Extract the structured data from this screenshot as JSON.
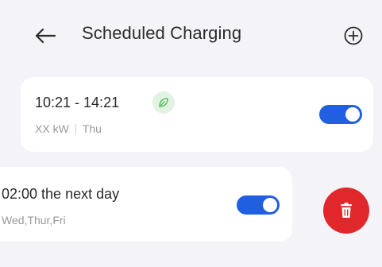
{
  "header": {
    "title": "Scheduled Charging",
    "back_icon": "arrow-left-icon",
    "add_icon": "plus-circle-icon"
  },
  "schedules": [
    {
      "time": "10:21 - 14:21",
      "power": "XX kW",
      "days": "Thu",
      "enabled": true,
      "status_icon": "leaf-icon"
    },
    {
      "time": "02:00 the next day",
      "days": "Wed,Thur,Fri",
      "enabled": true
    }
  ],
  "delete_icon": "trash-icon",
  "colors": {
    "background": "#f4f3f7",
    "card": "#ffffff",
    "toggle_on": "#1f5fe0",
    "delete": "#e0272b",
    "status_green": "#e2f3e4"
  }
}
